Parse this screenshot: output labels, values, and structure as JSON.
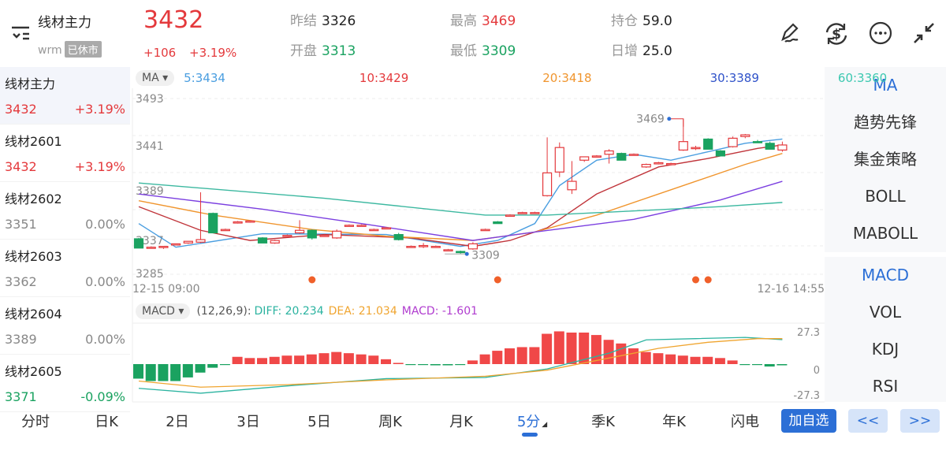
{
  "header": {
    "title": "线材主力",
    "code": "wrm",
    "status_badge": "已休市",
    "price": "3432",
    "change": "+106",
    "change_pct": "+3.19%",
    "stats": [
      {
        "k": "昨结",
        "v": "3326",
        "c": "n"
      },
      {
        "k": "开盘",
        "v": "3313",
        "c": "g"
      },
      {
        "k": "最高",
        "v": "3469",
        "c": "r"
      },
      {
        "k": "最低",
        "v": "3309",
        "c": "g"
      },
      {
        "k": "持仓",
        "v": "59.0",
        "c": "n"
      },
      {
        "k": "日增",
        "v": "25.0",
        "c": "n"
      }
    ]
  },
  "icons": [
    "sign-pen-icon",
    "currency-exchange-icon",
    "more-icon",
    "collapse-icon"
  ],
  "contracts": [
    {
      "name": "线材主力",
      "price": "3432",
      "pct": "+3.19%",
      "c": "r"
    },
    {
      "name": "线材2601",
      "price": "3432",
      "pct": "+3.19%",
      "c": "r"
    },
    {
      "name": "线材2602",
      "price": "3351",
      "pct": "0.00%",
      "c": "n"
    },
    {
      "name": "线材2603",
      "price": "3362",
      "pct": "0.00%",
      "c": "n"
    },
    {
      "name": "线材2604",
      "price": "3389",
      "pct": "0.00%",
      "c": "n"
    },
    {
      "name": "线材2605",
      "price": "3371",
      "pct": "-0.09%",
      "c": "g"
    }
  ],
  "indicators_main": [
    "MA",
    "趋势先锋",
    "集金策略",
    "BOLL",
    "MABOLL"
  ],
  "indicators_sub": [
    "MACD",
    "VOL",
    "KDJ",
    "RSI"
  ],
  "tabs": [
    "分时",
    "日K",
    "2日",
    "3日",
    "5日",
    "周K",
    "月K",
    "5分",
    "季K",
    "年K",
    "闪电"
  ],
  "active_tab": "5分",
  "add_watch": "加自选",
  "prev": "<<",
  "next": ">>",
  "ma_selector": "MA",
  "ma_legend": [
    {
      "t": "5:3434",
      "c": "#4a9ee0"
    },
    {
      "t": "10:3429",
      "c": "#e4393c"
    },
    {
      "t": "20:3418",
      "c": "#f0952e"
    },
    {
      "t": "30:3389",
      "c": "#2f52c9"
    },
    {
      "t": "60:3360",
      "c": "#3cc8b0"
    }
  ],
  "macd_selector": "MACD",
  "macd_params": "(12,26,9):",
  "macd_diff": "DIFF: 20.234",
  "macd_dea": "DEA: 21.034",
  "macd_val": "MACD: -1.601",
  "colors": {
    "up": "#e4393c",
    "down": "#1aa260",
    "accent": "#2c6fd6"
  },
  "chart_data": {
    "type": "candlestick",
    "y_ticks": [
      "3493",
      "3441",
      "3389",
      "3337",
      "3285"
    ],
    "ylim": [
      3285,
      3493
    ],
    "x_start": "12-15 09:00",
    "x_end": "12-16 14:55",
    "high_label": "3469",
    "low_label": "3309",
    "candles": [
      [
        3327,
        3328,
        3316,
        3316
      ],
      [
        3317,
        3318,
        3316,
        3317
      ],
      [
        3317,
        3318,
        3315,
        3318
      ],
      [
        3320,
        3321,
        3319,
        3321
      ],
      [
        3322,
        3324,
        3321,
        3324
      ],
      [
        3323,
        3382,
        3322,
        3326
      ],
      [
        3357,
        3358,
        3334,
        3334
      ],
      [
        3338,
        3339,
        3337,
        3338
      ],
      [
        3346,
        3348,
        3345,
        3347
      ],
      [
        3347,
        3348,
        3346,
        3348
      ],
      [
        3328,
        3329,
        3322,
        3322
      ],
      [
        3322,
        3326,
        3321,
        3325
      ],
      [
        3331,
        3332,
        3330,
        3331
      ],
      [
        3334,
        3349,
        3333,
        3337
      ],
      [
        3337,
        3338,
        3326,
        3328
      ],
      [
        3331,
        3332,
        3330,
        3331
      ],
      [
        3328,
        3338,
        3327,
        3336
      ],
      [
        3343,
        3344,
        3342,
        3343
      ],
      [
        3343,
        3344,
        3342,
        3343
      ],
      [
        3338,
        3339,
        3337,
        3338
      ],
      [
        3340,
        3341,
        3339,
        3340
      ],
      [
        3332,
        3334,
        3325,
        3326
      ],
      [
        3318,
        3319,
        3317,
        3318
      ],
      [
        3318,
        3322,
        3316,
        3319
      ],
      [
        3318,
        3319,
        3317,
        3318
      ],
      [
        3314,
        3315,
        3313,
        3314
      ],
      [
        3312,
        3313,
        3309,
        3311
      ],
      [
        3315,
        3323,
        3314,
        3321
      ],
      [
        3338,
        3339,
        3337,
        3338
      ],
      [
        3347,
        3348,
        3345,
        3345
      ],
      [
        3355,
        3356,
        3354,
        3355
      ],
      [
        3358,
        3359,
        3357,
        3358
      ],
      [
        3358,
        3359,
        3357,
        3358
      ],
      [
        3378,
        3447,
        3377,
        3405
      ],
      [
        3406,
        3441,
        3400,
        3435
      ],
      [
        3385,
        3419,
        3380,
        3395
      ],
      [
        3420,
        3424,
        3418,
        3424
      ],
      [
        3425,
        3426,
        3424,
        3425
      ],
      [
        3427,
        3433,
        3416,
        3431
      ],
      [
        3428,
        3429,
        3420,
        3420
      ],
      [
        3427,
        3428,
        3426,
        3427
      ],
      [
        3412,
        3416,
        3411,
        3415
      ],
      [
        3416,
        3418,
        3415,
        3417
      ],
      [
        3416,
        3417,
        3415,
        3416
      ],
      [
        3432,
        3469,
        3431,
        3442
      ],
      [
        3434,
        3437,
        3432,
        3435
      ],
      [
        3445,
        3446,
        3433,
        3433
      ],
      [
        3431,
        3432,
        3425,
        3425
      ],
      [
        3436,
        3448,
        3435,
        3446
      ],
      [
        3448,
        3451,
        3446,
        3450
      ],
      [
        3442,
        3444,
        3441,
        3441
      ],
      [
        3440,
        3442,
        3433,
        3433
      ],
      [
        3432,
        3442,
        3430,
        3438
      ]
    ],
    "ma": [
      {
        "name": "MA5",
        "color": "#4a9ee0",
        "points": [
          [
            0,
            3345
          ],
          [
            3,
            3317
          ],
          [
            10,
            3333
          ],
          [
            20,
            3332
          ],
          [
            26,
            3318
          ],
          [
            29,
            3325
          ],
          [
            32,
            3345
          ],
          [
            34,
            3390
          ],
          [
            37,
            3420
          ],
          [
            40,
            3427
          ],
          [
            43,
            3420
          ],
          [
            46,
            3430
          ],
          [
            49,
            3440
          ],
          [
            52,
            3445
          ]
        ]
      },
      {
        "name": "MA10",
        "color": "#c0343a",
        "points": [
          [
            0,
            3365
          ],
          [
            5,
            3337
          ],
          [
            9,
            3325
          ],
          [
            15,
            3332
          ],
          [
            22,
            3328
          ],
          [
            27,
            3318
          ],
          [
            30,
            3325
          ],
          [
            33,
            3340
          ],
          [
            37,
            3380
          ],
          [
            42,
            3412
          ],
          [
            46,
            3422
          ],
          [
            50,
            3434
          ],
          [
            52,
            3438
          ]
        ]
      },
      {
        "name": "MA20",
        "color": "#f0952e",
        "points": [
          [
            0,
            3372
          ],
          [
            6,
            3355
          ],
          [
            14,
            3338
          ],
          [
            20,
            3330
          ],
          [
            27,
            3325
          ],
          [
            32,
            3335
          ],
          [
            37,
            3355
          ],
          [
            44,
            3390
          ],
          [
            49,
            3415
          ],
          [
            52,
            3428
          ]
        ]
      },
      {
        "name": "MA30",
        "color": "#7b3fe0",
        "points": [
          [
            0,
            3380
          ],
          [
            10,
            3362
          ],
          [
            18,
            3345
          ],
          [
            27,
            3325
          ],
          [
            32,
            3335
          ],
          [
            40,
            3350
          ],
          [
            47,
            3373
          ],
          [
            52,
            3395
          ]
        ]
      },
      {
        "name": "MA60",
        "color": "#3cb8a0",
        "points": [
          [
            0,
            3393
          ],
          [
            15,
            3375
          ],
          [
            28,
            3355
          ],
          [
            33,
            3355
          ],
          [
            47,
            3365
          ],
          [
            52,
            3370
          ]
        ]
      }
    ],
    "markers": [
      14,
      29,
      45,
      46
    ],
    "macd": {
      "y_ticks": [
        "27.3",
        "0",
        "-27.3"
      ],
      "ylim": [
        -27.3,
        27.3
      ],
      "hist": [
        -12,
        -14,
        -14,
        -14,
        -11,
        -7,
        -3,
        -0.5,
        6,
        5,
        5,
        6,
        7,
        7,
        8,
        9,
        10,
        9,
        8,
        7,
        4,
        1,
        0,
        -0.5,
        -1,
        -1,
        0,
        3,
        8,
        11,
        13,
        14,
        14,
        25,
        27,
        26,
        26,
        24,
        20,
        17,
        13,
        10,
        9,
        8,
        7,
        6,
        6,
        5,
        3,
        -0.5,
        -0.5,
        -2,
        -1
      ],
      "diff": [
        [
          0,
          -20
        ],
        [
          5,
          -24
        ],
        [
          12,
          -18
        ],
        [
          20,
          -12
        ],
        [
          28,
          -11
        ],
        [
          33,
          -4
        ],
        [
          38,
          9
        ],
        [
          41,
          20
        ],
        [
          45,
          21
        ],
        [
          49,
          22
        ],
        [
          52,
          20.2
        ]
      ],
      "dea": [
        [
          0,
          -14
        ],
        [
          5,
          -19
        ],
        [
          12,
          -17
        ],
        [
          20,
          -13
        ],
        [
          28,
          -10
        ],
        [
          33,
          -5
        ],
        [
          38,
          5
        ],
        [
          42,
          13
        ],
        [
          46,
          18
        ],
        [
          50,
          21
        ],
        [
          52,
          21
        ]
      ]
    }
  }
}
